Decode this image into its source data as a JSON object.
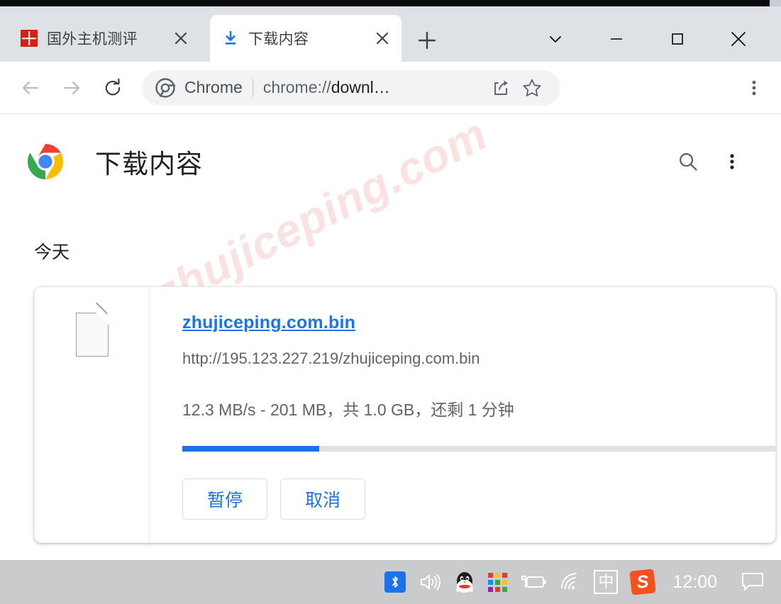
{
  "window": {
    "controls": [
      {
        "name": "tab-search",
        "glyph": "chevron-down"
      },
      {
        "name": "minimize",
        "glyph": "minus"
      },
      {
        "name": "maximize",
        "glyph": "square"
      },
      {
        "name": "close",
        "glyph": "cross"
      }
    ]
  },
  "tabs": [
    {
      "title": "国外主机测评",
      "favicon": "red-site-icon",
      "active": false,
      "close_label": "✕"
    },
    {
      "title": "下载内容",
      "favicon": "download-icon",
      "active": true,
      "close_label": "✕"
    }
  ],
  "new_tab_label": "+",
  "toolbar": {
    "back_label": "←",
    "forward_label": "→",
    "reload_label": "⟳",
    "omnibox": {
      "chip_label": "Chrome",
      "url_prefix": "chrome://",
      "url_highlight": "downl",
      "url_suffix": "…",
      "share_icon": "share-icon",
      "bookmark_icon": "star-icon"
    },
    "menu_icon": "three-dot-menu-icon"
  },
  "downloads_page": {
    "title": "下载内容",
    "logo": "chrome-logo",
    "search_icon": "search-icon",
    "menu_icon": "three-dot-menu-icon",
    "section_label": "今天",
    "watermark": "zhujiceping.com",
    "item": {
      "file_icon": "generic-file-icon",
      "filename": "zhujiceping.com.bin",
      "url": "http://195.123.227.219/zhujiceping.com.bin",
      "status": "12.3 MB/s - 201 MB，共 1.0 GB，还剩 1 分钟",
      "progress_percent": 23,
      "pause_label": "暂停",
      "cancel_label": "取消"
    }
  },
  "taskbar": {
    "clock": "12:00",
    "ime_label": "中",
    "sogou_label": "S",
    "tray": [
      {
        "name": "bluetooth-icon"
      },
      {
        "name": "volume-icon"
      },
      {
        "name": "qq-icon"
      },
      {
        "name": "color-grid-icon"
      },
      {
        "name": "battery-charging-icon"
      },
      {
        "name": "wifi-icon"
      },
      {
        "name": "ime-icon"
      },
      {
        "name": "sogou-input-icon"
      },
      {
        "name": "notification-icon"
      }
    ]
  },
  "colors": {
    "accent_blue": "#1a73e8",
    "tabstrip_bg": "#dee1e6",
    "taskbar_bg": "#c9cbcc",
    "watermark_pink": "#fbe2e2"
  }
}
